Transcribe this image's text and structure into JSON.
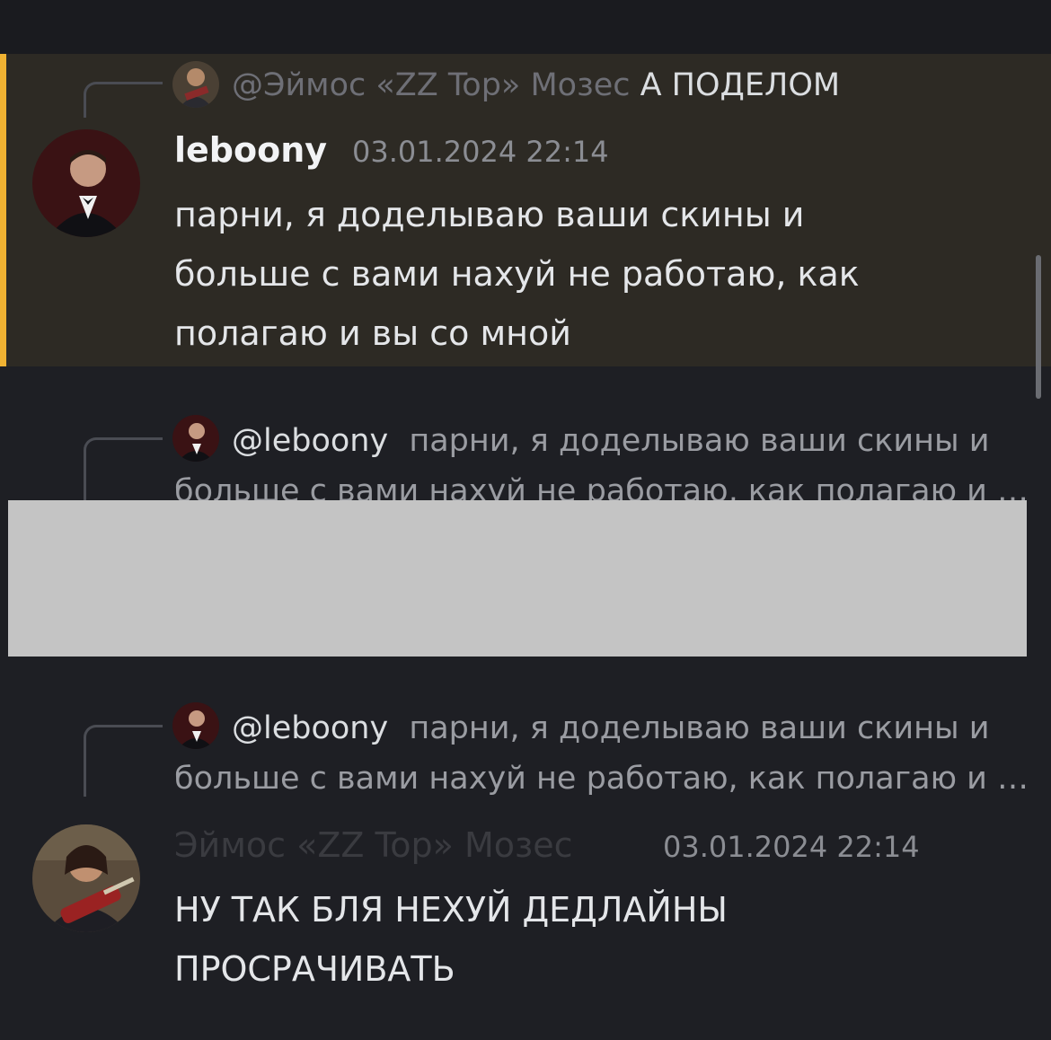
{
  "messages": [
    {
      "reply": {
        "author": "@Эймос «ZZ Top» Мозес",
        "snippet": "А ПОДЕЛОМ"
      },
      "author": "leboony",
      "timestamp": "03.01.2024 22:14",
      "content_lines": [
        "парни, я доделываю ваши скины и",
        "больше с вами нахуй не работаю, как",
        "полагаю и вы со мной"
      ],
      "highlighted": true
    },
    {
      "reply": {
        "mention": "@leboony",
        "snippet_line1": "парни, я доделываю ваши скины и",
        "snippet_line2": "больше с вами нахуй не работаю, как полагаю и …"
      },
      "redacted": true
    },
    {
      "reply": {
        "mention": "@leboony",
        "snippet_line1": "парни, я доделываю ваши скины и",
        "snippet_line2": "больше с вами нахуй не работаю, как полагаю и …"
      },
      "author": "Эймос «ZZ Top» Мозес",
      "timestamp": "03.01.2024 22:14",
      "content_lines": [
        "НУ ТАК БЛЯ НЕХУЙ ДЕДЛАЙНЫ",
        "ПРОСРАЧИВАТЬ"
      ]
    }
  ],
  "colors": {
    "highlight_bar": "#f0b232",
    "highlight_bg": "#2d2a24",
    "background": "#1e1f24"
  },
  "icons": [
    "guitarist-avatar",
    "tuxedo-man-avatar"
  ]
}
